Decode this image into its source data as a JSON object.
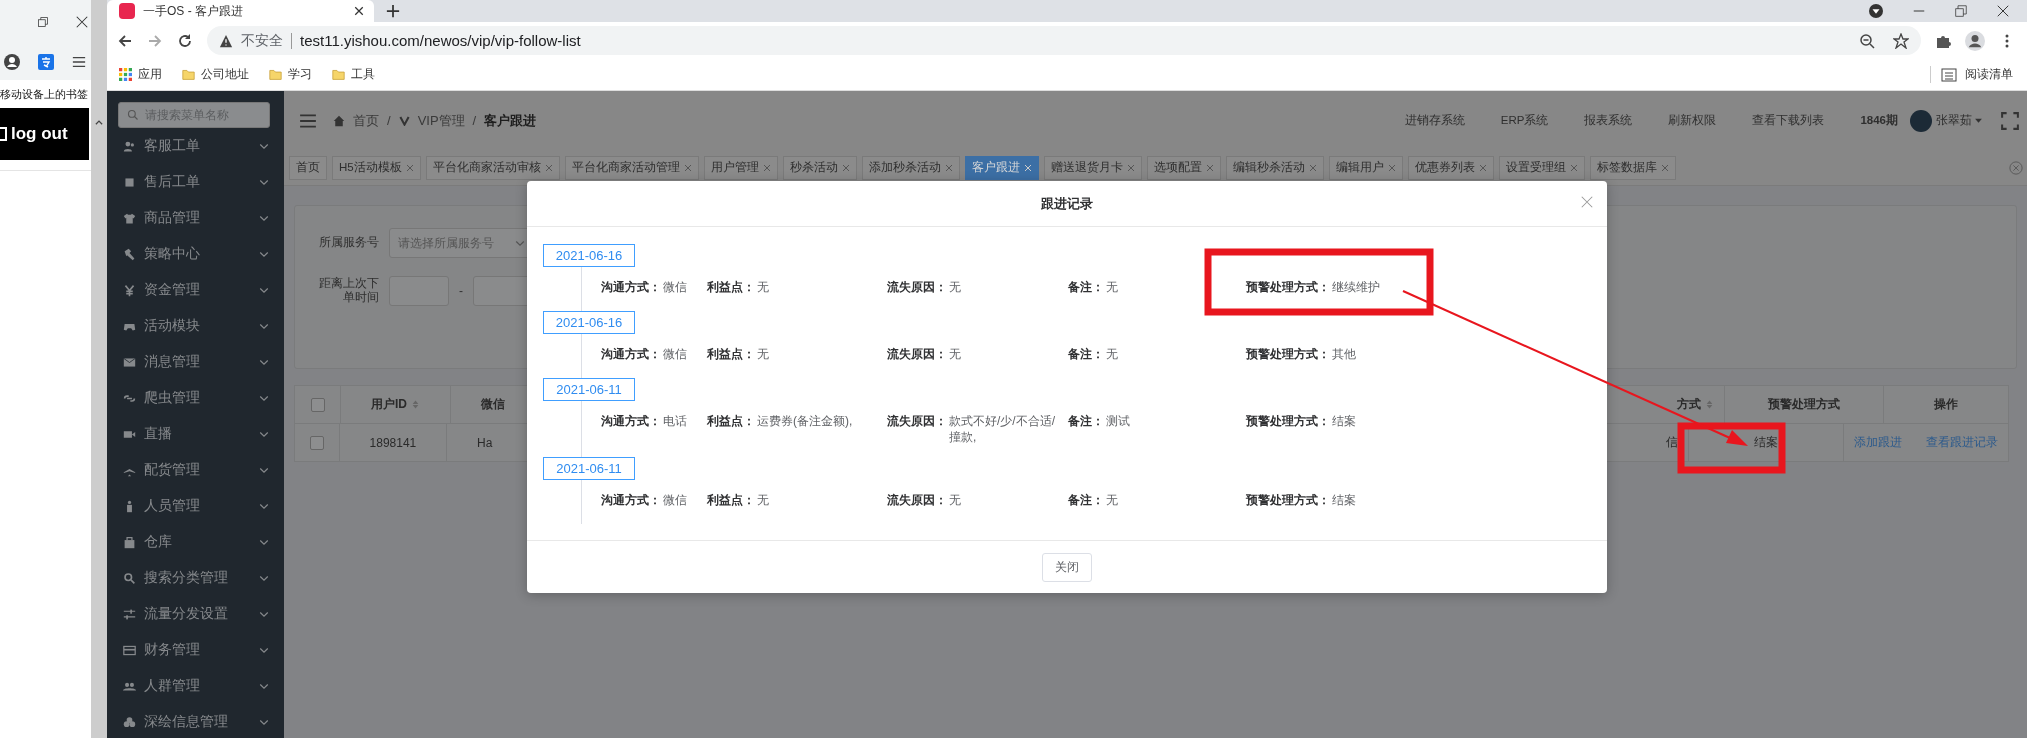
{
  "side_window": {
    "bookmarks_label": "移动设备上的书签",
    "logout_label": "log out"
  },
  "browser": {
    "tab_title": "一手OS - 客户跟进",
    "security_label": "不安全",
    "url": "test11.yishou.com/newos/vip/vip-follow-list",
    "bookmarks": [
      {
        "label": "应用",
        "kind": "apps"
      },
      {
        "label": "公司地址",
        "kind": "folder"
      },
      {
        "label": "学习",
        "kind": "folder"
      },
      {
        "label": "工具",
        "kind": "folder"
      }
    ],
    "reading_list": "阅读清单"
  },
  "sidebar": {
    "search_placeholder": "请搜索菜单名称",
    "items": [
      "客服工单",
      "售后工单",
      "商品管理",
      "策略中心",
      "资金管理",
      "活动模块",
      "消息管理",
      "爬虫管理",
      "直播",
      "配货管理",
      "人员管理",
      "仓库",
      "搜索分类管理",
      "流量分发设置",
      "财务管理",
      "人群管理",
      "深绘信息管理"
    ]
  },
  "header": {
    "breadcrumb": [
      "首页",
      "VIP管理",
      "客户跟进"
    ],
    "separators": [
      "/",
      "/"
    ],
    "links": [
      "进销存系统",
      "ERP系统",
      "报表系统",
      "刷新权限",
      "查看下载列表"
    ],
    "period": "1846期",
    "user": "张翠茹"
  },
  "tabs": [
    {
      "label": "首页",
      "selected": false,
      "closable": false
    },
    {
      "label": "H5活动模板",
      "selected": false,
      "closable": true
    },
    {
      "label": "平台化商家活动审核",
      "selected": false,
      "closable": true
    },
    {
      "label": "平台化商家活动管理",
      "selected": false,
      "closable": true
    },
    {
      "label": "用户管理",
      "selected": false,
      "closable": true
    },
    {
      "label": "秒杀活动",
      "selected": false,
      "closable": true
    },
    {
      "label": "添加秒杀活动",
      "selected": false,
      "closable": true
    },
    {
      "label": "客户跟进",
      "selected": true,
      "closable": true
    },
    {
      "label": "赠送退货月卡",
      "selected": false,
      "closable": true
    },
    {
      "label": "选项配置",
      "selected": false,
      "closable": true
    },
    {
      "label": "编辑秒杀活动",
      "selected": false,
      "closable": true
    },
    {
      "label": "编辑用户",
      "selected": false,
      "closable": true
    },
    {
      "label": "优惠券列表",
      "selected": false,
      "closable": true
    },
    {
      "label": "设置受理组",
      "selected": false,
      "closable": true
    },
    {
      "label": "标签数据库",
      "selected": false,
      "closable": true
    }
  ],
  "filter": {
    "service_label": "所属服务号",
    "service_placeholder": "请选择所属服务号",
    "interval_label": "距离上次下单时间",
    "range_separator": "-"
  },
  "table": {
    "select_all_checked": false,
    "columns": [
      {
        "label": "用户ID",
        "sortable": true
      },
      {
        "label": "微信",
        "sortable": false
      },
      {
        "label": "方式",
        "sortable": true
      },
      {
        "label": "预警处理方式",
        "sortable": false
      },
      {
        "label": "操作",
        "sortable": false
      }
    ],
    "rows": [
      {
        "checked": false,
        "cells": [
          "1898141",
          "Ha",
          "信",
          "结案"
        ],
        "actions": [
          "添加跟进",
          "查看跟进记录"
        ]
      }
    ]
  },
  "dialog": {
    "title": "跟进记录",
    "close_button": "关闭",
    "records": [
      {
        "date": "2021-06-16",
        "fields": [
          {
            "label": "沟通方式：",
            "value": "微信"
          },
          {
            "label": "利益点：",
            "value": "无"
          },
          {
            "label": "流失原因：",
            "value": "无"
          },
          {
            "label": "备注：",
            "value": "无"
          },
          {
            "label": "预警处理方式：",
            "value": "继续维护"
          }
        ]
      },
      {
        "date": "2021-06-16",
        "fields": [
          {
            "label": "沟通方式：",
            "value": "微信"
          },
          {
            "label": "利益点：",
            "value": "无"
          },
          {
            "label": "流失原因：",
            "value": "无"
          },
          {
            "label": "备注：",
            "value": "无"
          },
          {
            "label": "预警处理方式：",
            "value": "其他"
          }
        ]
      },
      {
        "date": "2021-06-11",
        "fields": [
          {
            "label": "沟通方式：",
            "value": "电话"
          },
          {
            "label": "利益点：",
            "value": "运费券(备注金额),"
          },
          {
            "label": "流失原因：",
            "value": "款式不好/少/不合适/撞款,"
          },
          {
            "label": "备注：",
            "value": "测试"
          },
          {
            "label": "预警处理方式：",
            "value": "结案"
          }
        ]
      },
      {
        "date": "2021-06-11",
        "fields": [
          {
            "label": "沟通方式：",
            "value": "微信"
          },
          {
            "label": "利益点：",
            "value": "无"
          },
          {
            "label": "流失原因：",
            "value": "无"
          },
          {
            "label": "备注：",
            "value": "无"
          },
          {
            "label": "预警处理方式：",
            "value": "结案"
          }
        ]
      }
    ]
  }
}
